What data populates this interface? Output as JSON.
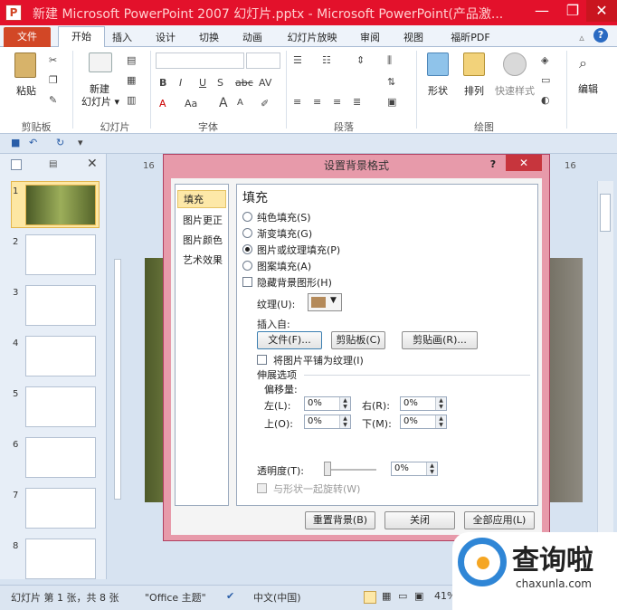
{
  "window": {
    "title": "新建 Microsoft PowerPoint 2007 幻灯片.pptx - Microsoft PowerPoint(产品激...",
    "app_icon": "P",
    "minimize": "—",
    "restore": "❐",
    "close": "✕"
  },
  "tabs": [
    "文件",
    "开始",
    "插入",
    "设计",
    "切换",
    "动画",
    "幻灯片放映",
    "审阅",
    "视图",
    "福昕PDF"
  ],
  "ribbon": {
    "clipboard": {
      "paste": "粘贴",
      "group": "剪贴板"
    },
    "slides": {
      "new_slide_1": "新建",
      "new_slide_2": "幻灯片 ▾",
      "group": "幻灯片"
    },
    "font": {
      "group": "字体",
      "bold": "B",
      "italic": "I",
      "underline": "U",
      "strike": "S",
      "abc": "abc",
      "av": "AV",
      "font_color": "A",
      "aa": "Aa",
      "grow": "A",
      "shrink": "A"
    },
    "paragraph": {
      "group": "段落"
    },
    "drawing": {
      "shapes": "形状",
      "arrange": "排列",
      "quick_styles": "快速样式",
      "group": "绘图"
    },
    "editing": {
      "label": "编辑"
    }
  },
  "slide_numbers": [
    "1",
    "2",
    "3",
    "4",
    "5",
    "6",
    "7",
    "8"
  ],
  "ruler": {
    "top_left": "16",
    "top_right": "16"
  },
  "dialog": {
    "title": "设置背景格式",
    "help": "?",
    "close": "✕",
    "nav": [
      "填充",
      "图片更正",
      "图片颜色",
      "艺术效果"
    ],
    "heading": "填充",
    "options": [
      "纯色填充(S)",
      "渐变填充(G)",
      "图片或纹理填充(P)",
      "图案填充(A)"
    ],
    "selected_option": 2,
    "hide_bg": "隐藏背景图形(H)",
    "texture_label": "纹理(U):",
    "insert_from": "插入自:",
    "file_btn": "文件(F)...",
    "clipboard_btn": "剪贴板(C)",
    "clipart_btn": "剪贴画(R)...",
    "tile": "将图片平铺为纹理(I)",
    "stretch": "伸展选项",
    "offset": "偏移量:",
    "left_label": "左(L):",
    "left_val": "0%",
    "right_label": "右(R):",
    "right_val": "0%",
    "top_label": "上(O):",
    "top_val": "0%",
    "bottom_label": "下(M):",
    "bottom_val": "0%",
    "transparency_label": "透明度(T):",
    "transparency_val": "0%",
    "rotate": "与形状一起旋转(W)",
    "reset_btn": "重置背景(B)",
    "close_btn": "关闭",
    "apply_all_btn": "全部应用(L)"
  },
  "status": {
    "slide": "幻灯片 第 1 张，共 8 张",
    "theme": "\"Office 主题\"",
    "lang": "中文(中国)",
    "zoom": "41%"
  },
  "watermark": {
    "brand": "查询啦",
    "url": "chaxunla.com"
  }
}
